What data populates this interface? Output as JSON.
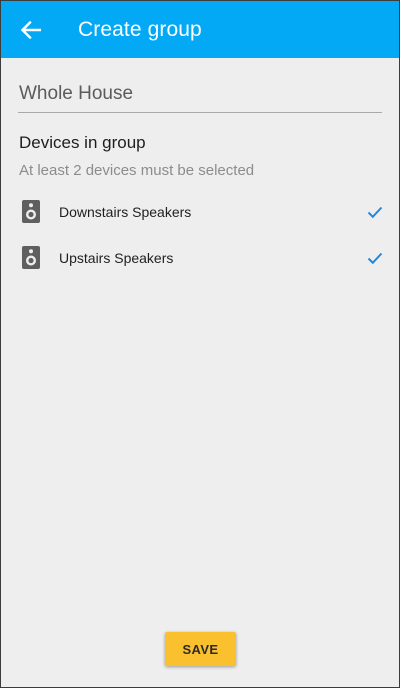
{
  "appbar": {
    "title": "Create group",
    "back_icon": "arrow-left-icon",
    "color": "#03a9f4"
  },
  "group_name": {
    "value": "Whole House"
  },
  "devices_section": {
    "title": "Devices in group",
    "hint": "At least 2 devices must be selected"
  },
  "devices": [
    {
      "label": "Downstairs Speakers",
      "icon": "speaker-icon",
      "selected": true
    },
    {
      "label": "Upstairs Speakers",
      "icon": "speaker-icon",
      "selected": true
    }
  ],
  "save_button": {
    "label": "SAVE",
    "color": "#fbc02d"
  },
  "check_color": "#1e88e5"
}
